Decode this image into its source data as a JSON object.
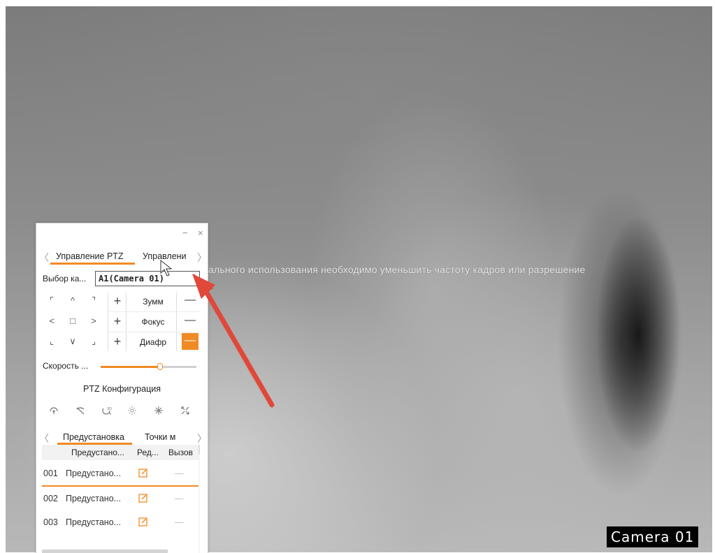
{
  "overlay": {
    "message": "ального использования необходимо уменьшить частоту кадров или разрешение",
    "camera_label": "Camera 01"
  },
  "panel": {
    "window": {
      "minimize_icon": "minimize-icon",
      "close_icon": "close-icon",
      "minimize": "−",
      "close": "×"
    },
    "tabs": {
      "prev": "〈",
      "next": "〉",
      "items": [
        {
          "label": "Управление PTZ",
          "active": true
        },
        {
          "label": "Управлени",
          "active": false
        }
      ]
    },
    "camera_select": {
      "label": "Выбор ка...",
      "value": "A1(Camera 01)"
    },
    "ptz": {
      "directions": [
        "⌜",
        "^",
        "⌝",
        "<",
        "□",
        ">",
        "⌞",
        "∨",
        "⌟"
      ],
      "controls": [
        {
          "plus": "+",
          "label": "Зумм",
          "minus": "—",
          "active": false
        },
        {
          "plus": "+",
          "label": "Фокус",
          "minus": "—",
          "active": false
        },
        {
          "plus": "+",
          "label": "Диафр",
          "minus": "—",
          "active": true
        }
      ]
    },
    "speed": {
      "label": "Скорость ...",
      "value_fraction": 0.62
    },
    "config_title": "PTZ Конфигурация",
    "config_icons": [
      "wiper-icon",
      "no-light-icon",
      "3d-position-icon",
      "light-icon",
      "defog-icon",
      "zoom-area-icon"
    ],
    "sub_tabs": {
      "prev": "〈",
      "next": "〉",
      "items": [
        {
          "label": "Предустановка",
          "active": true
        },
        {
          "label": "Точки м",
          "active": false
        }
      ]
    },
    "presets_table": {
      "columns": [
        "Предустано...",
        "Ред...",
        "Вызов"
      ],
      "rows": [
        {
          "id": "001",
          "name": "Предустано...",
          "call": "—"
        },
        {
          "id": "002",
          "name": "Предустано...",
          "call": "—"
        },
        {
          "id": "003",
          "name": "Предустано...",
          "call": "—"
        }
      ]
    }
  },
  "colors": {
    "accent": "#f08a24",
    "arrow": "#e0483a"
  }
}
